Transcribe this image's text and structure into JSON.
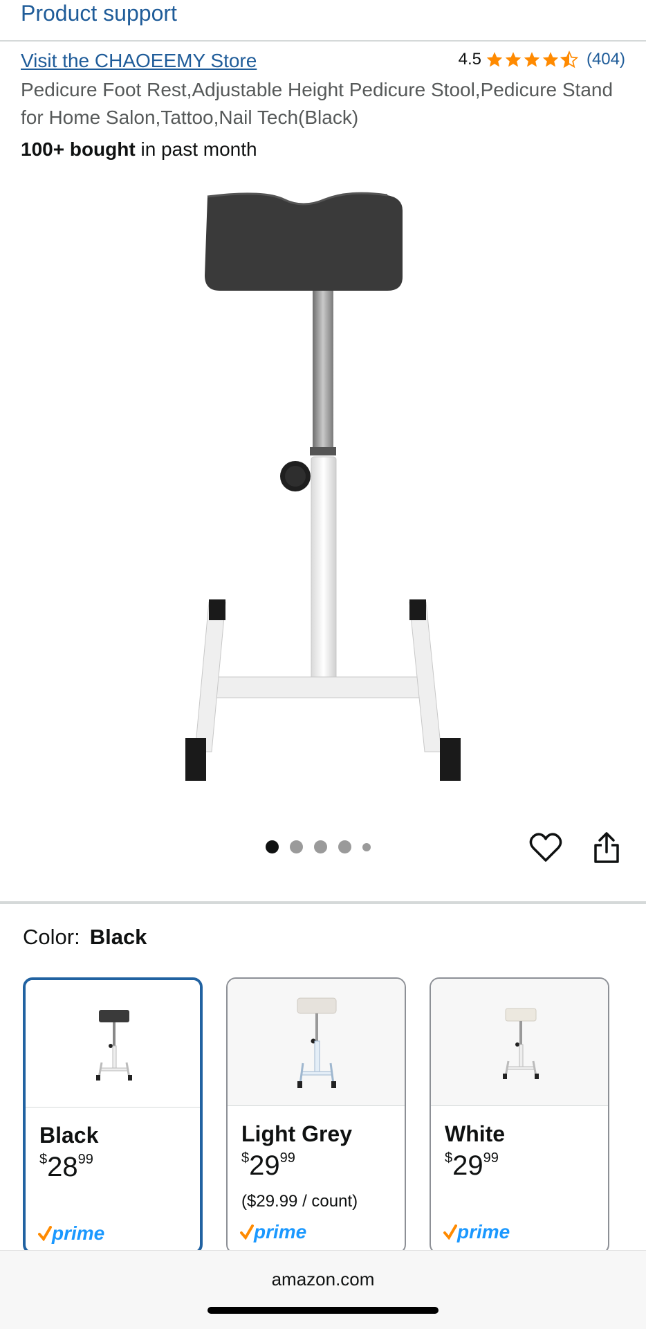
{
  "header": {
    "title": "Product support"
  },
  "store": {
    "link_label": "Visit the CHAOEEMY Store",
    "rating_value": "4.5",
    "rating_stars": 4.5,
    "rating_count": "(404)",
    "star_color": "#ff8a00"
  },
  "product": {
    "title": "Pedicure Foot Rest,Adjustable Height Pedicure Stool,Pedicure Stand for Home Salon,Tattoo,Nail Tech(Black)",
    "bought_bold": "100+ bought",
    "bought_rest": " in past month"
  },
  "gallery": {
    "image_count": 5,
    "active_index": 0,
    "heart_icon": "heart-icon",
    "share_icon": "share-icon"
  },
  "color": {
    "label": "Color:",
    "selected": "Black",
    "options": [
      {
        "name": "Black",
        "currency": "$",
        "whole": "28",
        "fraction": "99",
        "unit": "",
        "prime": "prime",
        "selected": true
      },
      {
        "name": "Light Grey",
        "currency": "$",
        "whole": "29",
        "fraction": "99",
        "unit": "($29.99 / count)",
        "prime": "prime",
        "selected": false
      },
      {
        "name": "White",
        "currency": "$",
        "whole": "29",
        "fraction": "99",
        "unit": "",
        "prime": "prime",
        "selected": false
      }
    ]
  },
  "browser": {
    "url": "amazon.com"
  },
  "colors": {
    "link": "#1f5c99",
    "selected_border": "#2162a1",
    "prime_blue": "#1a98ff",
    "prime_check": "#ff8a00"
  }
}
